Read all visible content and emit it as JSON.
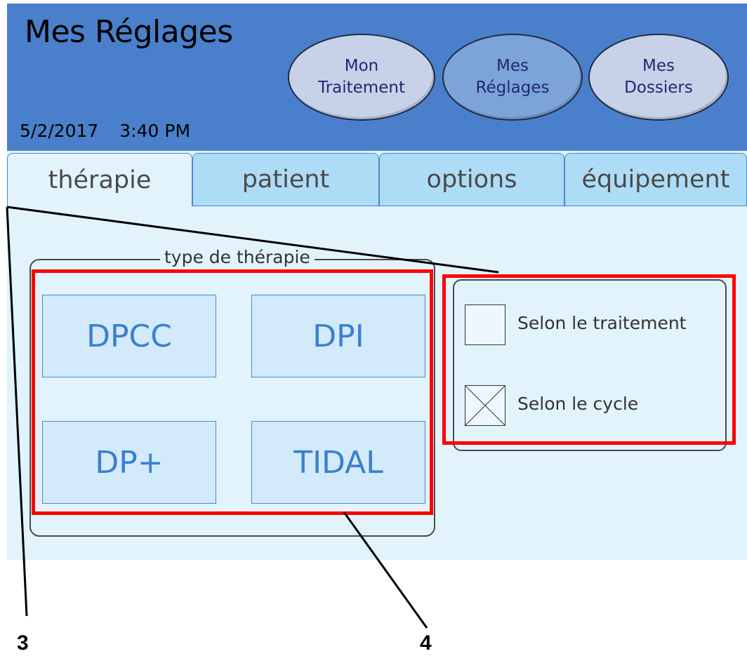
{
  "header": {
    "title": "Mes Réglages",
    "date": "5/2/2017",
    "time": "3:40 PM",
    "nav": [
      {
        "line1": "Mon",
        "line2": "Traitement",
        "state": "inactive"
      },
      {
        "line1": "Mes",
        "line2": "Réglages",
        "state": "active"
      },
      {
        "line1": "Mes",
        "line2": "Dossiers",
        "state": "inactive"
      }
    ]
  },
  "tabs": [
    {
      "label": "thérapie",
      "state": "active"
    },
    {
      "label": "patient",
      "state": "inactive"
    },
    {
      "label": "options",
      "state": "inactive"
    },
    {
      "label": "équipement",
      "state": "inactive"
    }
  ],
  "therapy_group": {
    "legend": "type de thérapie",
    "buttons": [
      "DPCC",
      "DPI",
      "DP+",
      "TIDAL"
    ]
  },
  "options": [
    {
      "label": "Selon le traitement",
      "checked": false
    },
    {
      "label": "Selon le cycle",
      "checked": true
    }
  ],
  "callouts": [
    "3",
    "4"
  ],
  "colors": {
    "header_bg": "#4a80cb",
    "screen_bg": "#e2f3fc",
    "highlight": "#ff0000",
    "button_text": "#3b7fd0"
  }
}
